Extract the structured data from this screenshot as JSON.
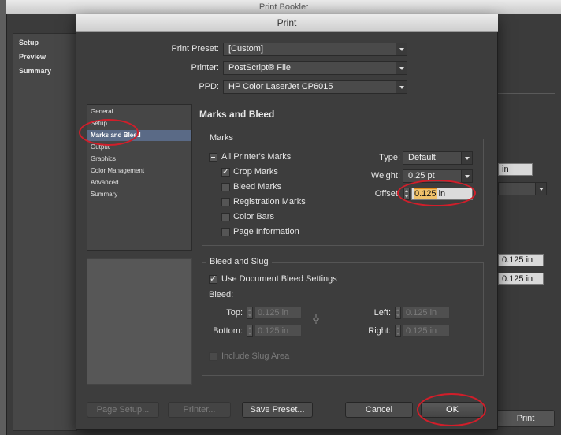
{
  "background": {
    "title": "Print Booklet",
    "sidebar": [
      "Setup",
      "Preview",
      "Summary"
    ],
    "field_units": "in",
    "field_a": "0.125 in",
    "field_b": "0.125 in",
    "print_button": "Print"
  },
  "dialog": {
    "title": "Print",
    "print_preset": {
      "label": "Print Preset:",
      "value": "[Custom]"
    },
    "printer": {
      "label": "Printer:",
      "value": "PostScript® File"
    },
    "ppd": {
      "label": "PPD:",
      "value": "HP Color LaserJet CP6015"
    }
  },
  "categories": [
    "General",
    "Setup",
    "Marks and Bleed",
    "Output",
    "Graphics",
    "Color Management",
    "Advanced",
    "Summary"
  ],
  "selected_category": "Marks and Bleed",
  "section_title": "Marks and Bleed",
  "marks": {
    "group_title": "Marks",
    "all_printers_marks": {
      "label": "All Printer's Marks",
      "state": "mixed"
    },
    "crop_marks": {
      "label": "Crop Marks",
      "checked": true
    },
    "bleed_marks": {
      "label": "Bleed Marks",
      "checked": false
    },
    "registration_marks": {
      "label": "Registration Marks",
      "checked": false
    },
    "color_bars": {
      "label": "Color Bars",
      "checked": false
    },
    "page_information": {
      "label": "Page Information",
      "checked": false
    },
    "type": {
      "label": "Type:",
      "value": "Default"
    },
    "weight": {
      "label": "Weight:",
      "value": "0.25 pt"
    },
    "offset": {
      "label": "Offset:",
      "value": "0.125",
      "unit": "in"
    }
  },
  "bleed_slug": {
    "group_title": "Bleed and Slug",
    "use_document_bleed": {
      "label": "Use Document Bleed Settings",
      "checked": true
    },
    "bleed_label": "Bleed:",
    "top": {
      "label": "Top:",
      "value": "0.125 in"
    },
    "bottom": {
      "label": "Bottom:",
      "value": "0.125 in"
    },
    "left": {
      "label": "Left:",
      "value": "0.125 in"
    },
    "right": {
      "label": "Right:",
      "value": "0.125 in"
    },
    "include_slug": {
      "label": "Include Slug Area",
      "checked": false
    }
  },
  "buttons": {
    "page_setup": "Page Setup...",
    "printer": "Printer...",
    "save_preset": "Save Preset...",
    "cancel": "Cancel",
    "ok": "OK"
  },
  "colors": {
    "annotation": "#d11e2a",
    "selection": "#5a6a86"
  }
}
